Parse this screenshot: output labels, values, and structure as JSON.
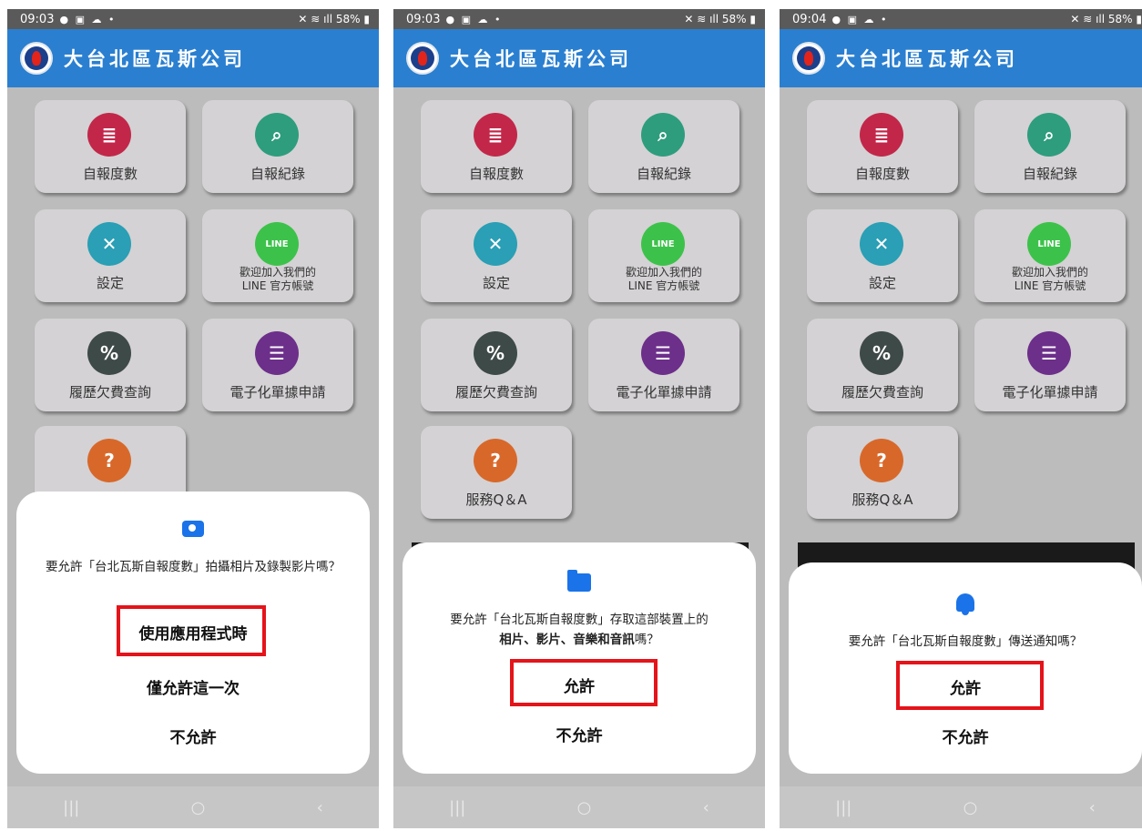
{
  "app": {
    "title": "大台北區瓦斯公司"
  },
  "menu": {
    "self_report": "自報度數",
    "report_records": "自報紀錄",
    "settings": "設定",
    "line_line1": "歡迎加入我們的",
    "line_line2": "LINE 官方帳號",
    "history": "履歷欠費查詢",
    "e_bill": "電子化單據申請",
    "faq": "服務Q＆A"
  },
  "screens": [
    {
      "status": {
        "time": "09:03",
        "battery": "58%"
      },
      "dialog": {
        "icon": "camera-icon",
        "message": "要允許「台北瓦斯自報度數」拍攝相片及錄製影片嗎？",
        "buttons": [
          "使用應用程式時",
          "僅允許這一次",
          "不允許"
        ],
        "highlighted": "使用應用程式時"
      }
    },
    {
      "status": {
        "time": "09:03",
        "battery": "58%"
      },
      "dialog": {
        "icon": "folder-icon",
        "message_prefix": "要允許「台北瓦斯自報度數」存取這部裝置上的",
        "message_bold": "相片、影片、音樂和音訊",
        "message_suffix": "嗎？",
        "buttons": [
          "允許",
          "不允許"
        ],
        "highlighted": "允許"
      }
    },
    {
      "status": {
        "time": "09:04",
        "battery": "58%"
      },
      "dialog": {
        "icon": "bell-icon",
        "message": "要允許「台北瓦斯自報度數」傳送通知嗎？",
        "buttons": [
          "允許",
          "不允許"
        ],
        "highlighted": "允許"
      }
    }
  ],
  "colors": {
    "appbar": "#2a7fd0",
    "highlight": "#e5131a",
    "dialog_icon": "#1a73e8"
  }
}
